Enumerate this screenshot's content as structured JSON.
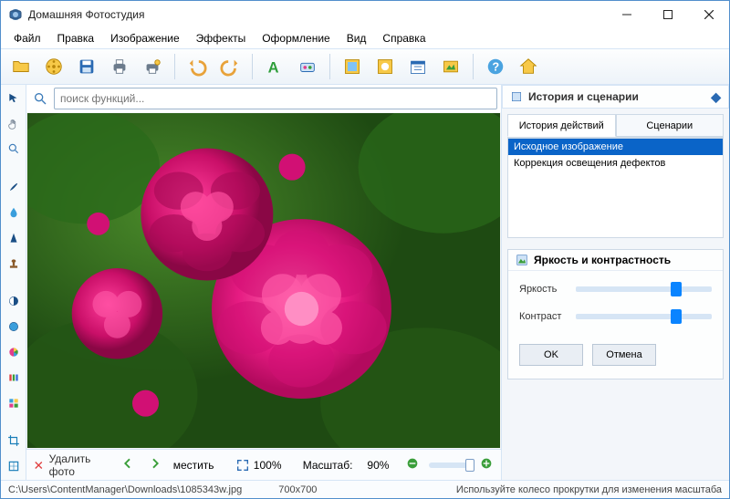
{
  "title": "Домашняя Фотостудия",
  "menu": [
    "Файл",
    "Правка",
    "Изображение",
    "Эффекты",
    "Оформление",
    "Вид",
    "Справка"
  ],
  "search": {
    "placeholder": "поиск функций..."
  },
  "bottom": {
    "delete_label": "Удалить фото",
    "move_label": "местить",
    "fit_label": "100%",
    "zoom_label": "Масштаб:",
    "zoom_value": "90%"
  },
  "right": {
    "history_title": "История и сценарии",
    "tabs": [
      "История действий",
      "Сценарии"
    ],
    "history_items": [
      "Исходное изображение",
      "Коррекция освещения дефектов"
    ],
    "panel2_title": "Яркость и контрастность",
    "slider1_label": "Яркость",
    "slider2_label": "Контраст",
    "ok_label": "OK",
    "cancel_label": "Отмена"
  },
  "status": {
    "path": "C:\\Users\\ContentManager\\Downloads\\1085343w.jpg",
    "dims": "700x700",
    "tip": "Используйте колесо прокрутки для изменения масштаба"
  },
  "colors": {
    "accent": "#0a84ff",
    "selected": "#0a64c8"
  }
}
